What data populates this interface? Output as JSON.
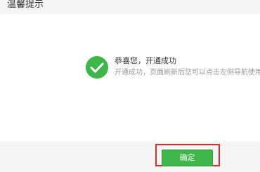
{
  "dialog": {
    "title": "温馨提示",
    "message": {
      "icon": "success-check-icon",
      "title": "恭喜您，开通成功",
      "detail": "开通成功，页面刷新后您可以点击左侧导航使用"
    },
    "ok_button_label": "确定"
  },
  "colors": {
    "success_green": "#3fb64a",
    "button_green": "#3fb64a",
    "highlight_red": "#d93025"
  }
}
